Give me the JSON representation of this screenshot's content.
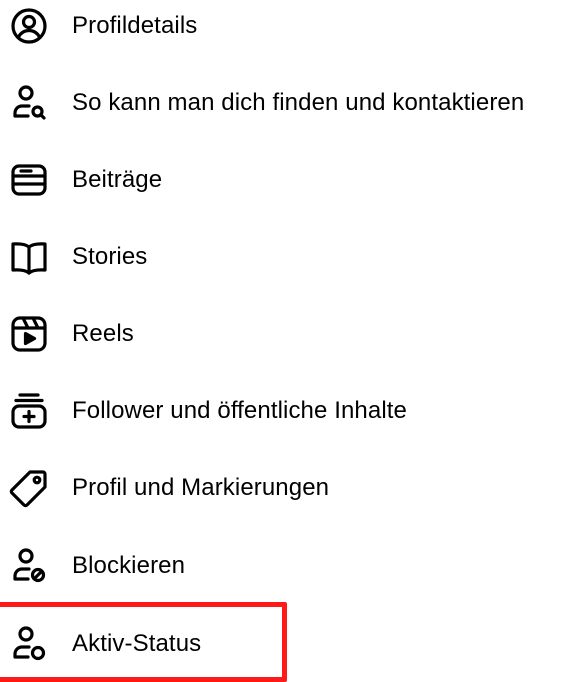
{
  "menu": {
    "items": [
      {
        "label": "Profildetails",
        "icon": "profile-circle-icon"
      },
      {
        "label": "So kann man dich finden und kontaktieren",
        "icon": "person-search-icon"
      },
      {
        "label": "Beiträge",
        "icon": "posts-icon"
      },
      {
        "label": "Stories",
        "icon": "book-icon"
      },
      {
        "label": "Reels",
        "icon": "reels-icon"
      },
      {
        "label": "Follower und öffentliche Inhalte",
        "icon": "stack-add-icon"
      },
      {
        "label": "Profil und Markierungen",
        "icon": "tag-icon"
      },
      {
        "label": "Blockieren",
        "icon": "person-block-icon"
      },
      {
        "label": "Aktiv-Status",
        "icon": "person-status-icon"
      }
    ]
  },
  "highlight": {
    "color": "#ff1a1a",
    "target": "Aktiv-Status"
  }
}
